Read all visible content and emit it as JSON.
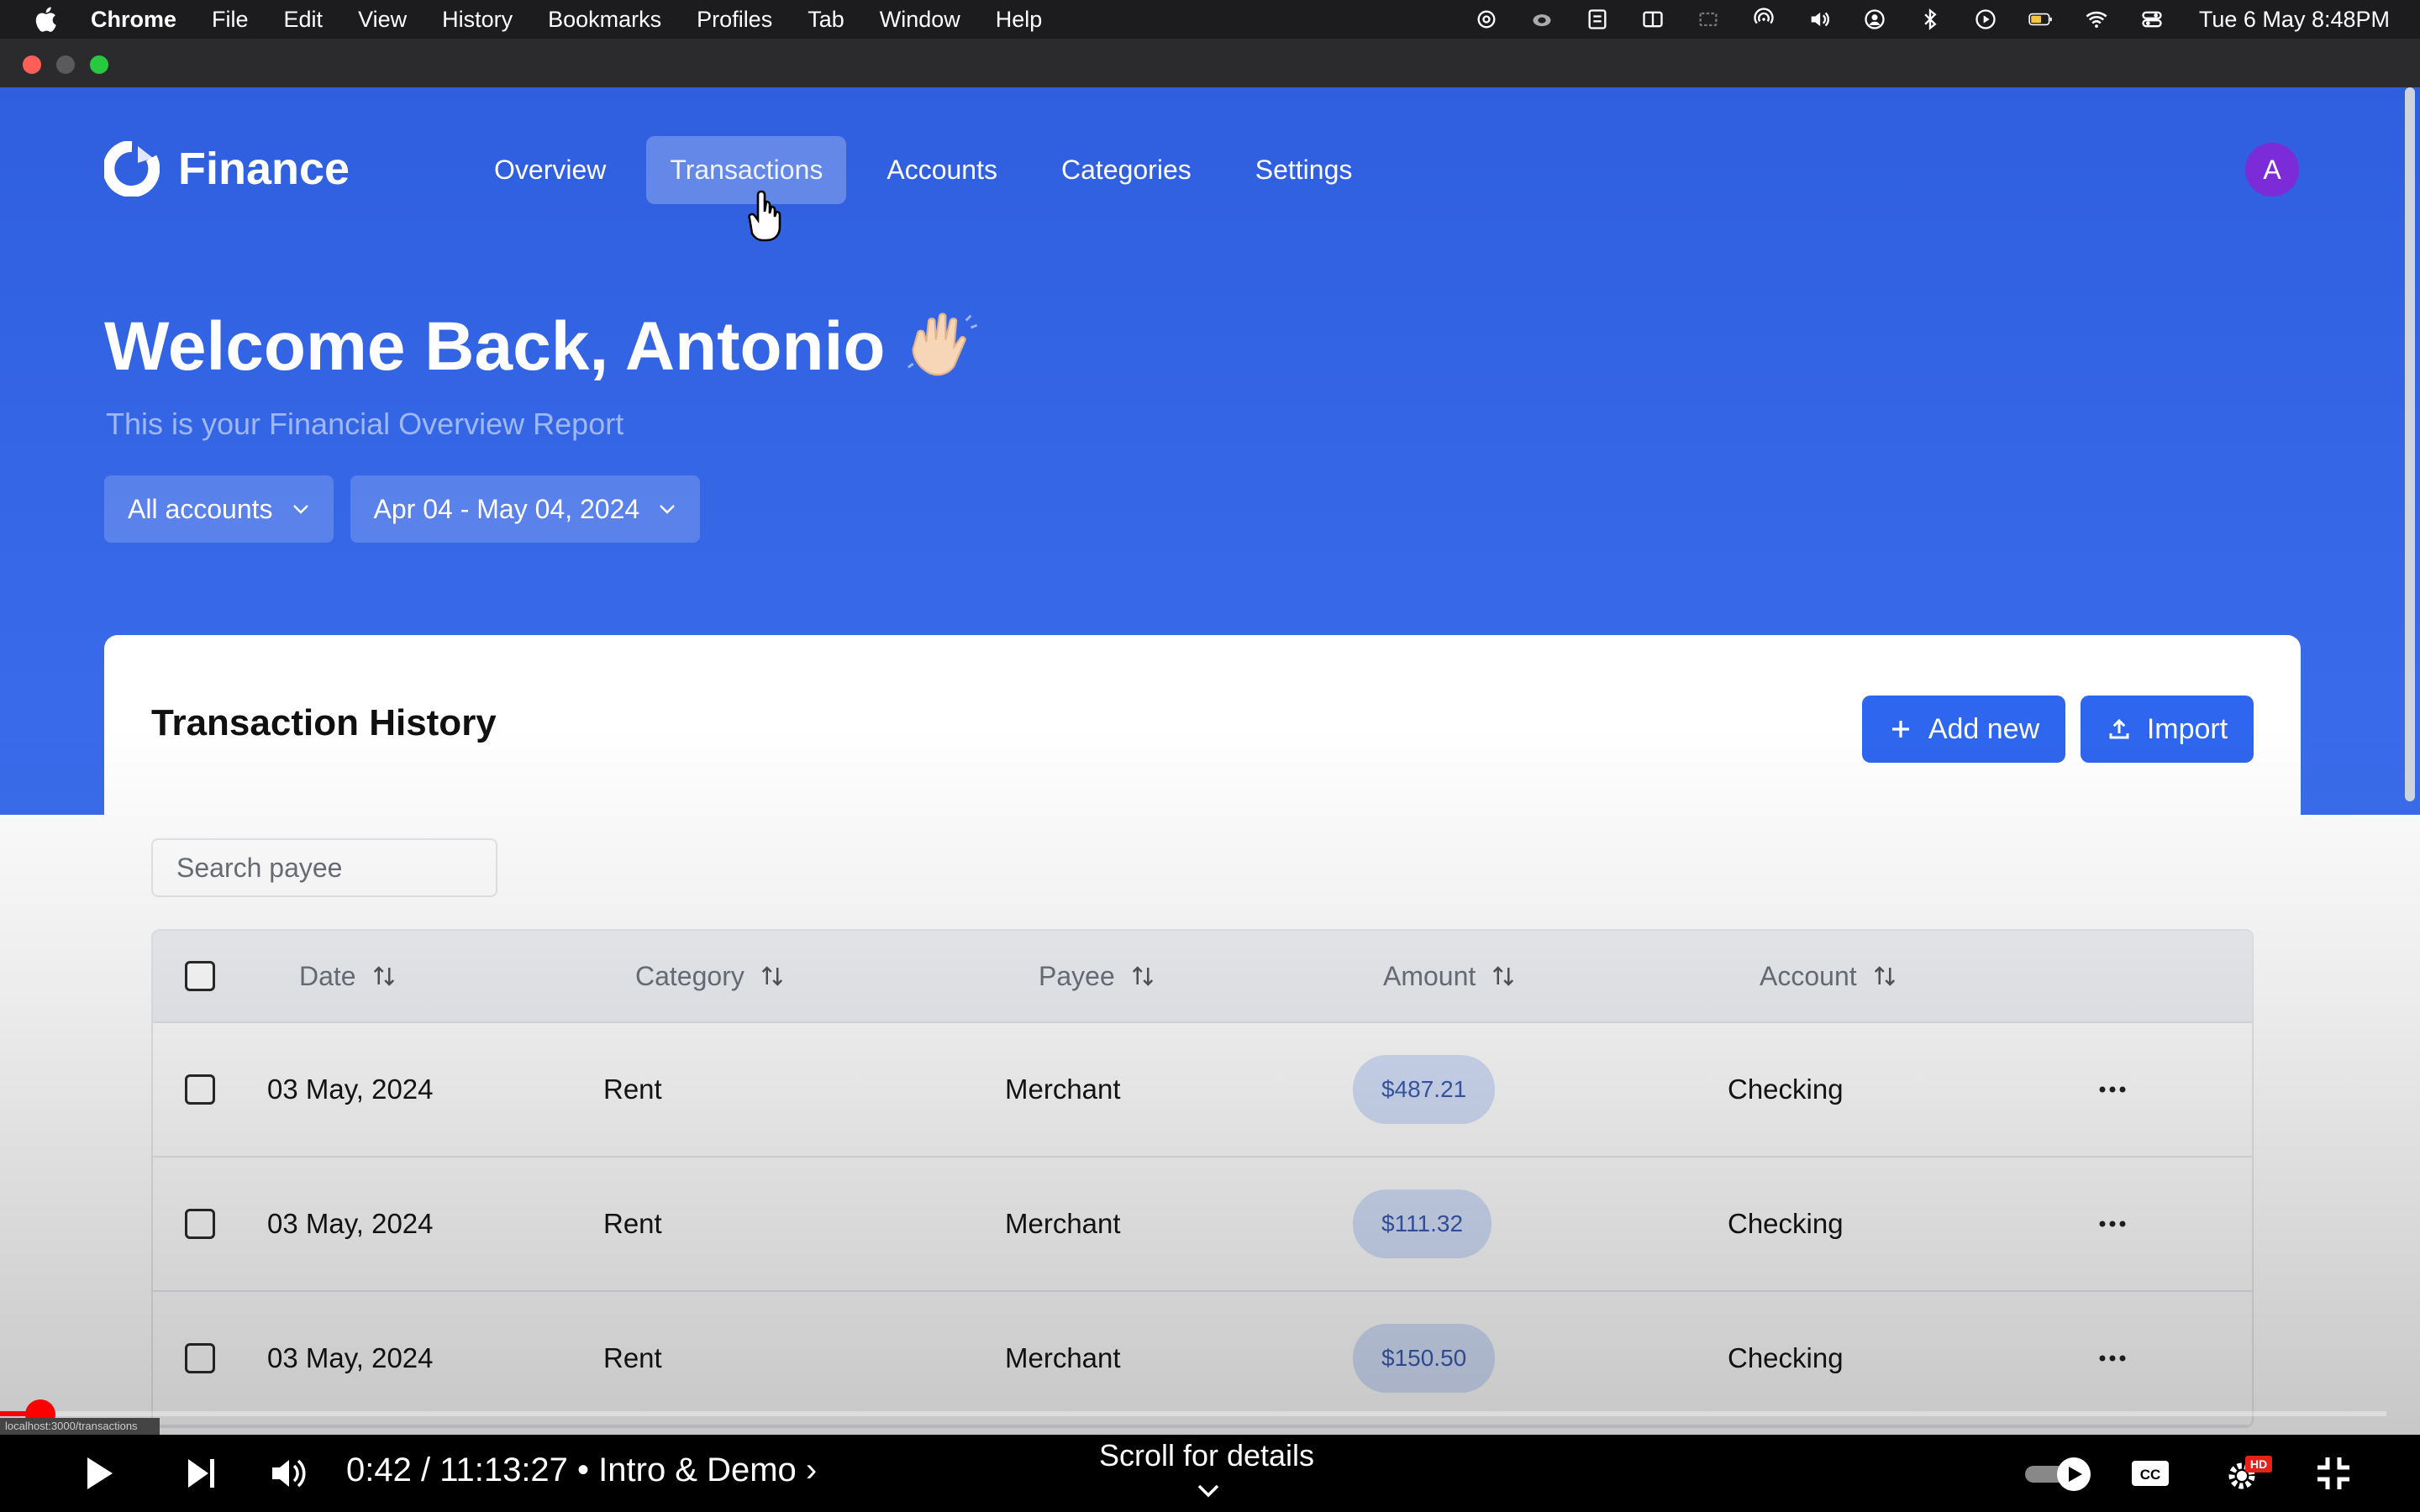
{
  "menubar": {
    "app": "Chrome",
    "items": [
      "File",
      "Edit",
      "View",
      "History",
      "Bookmarks",
      "Profiles",
      "Tab",
      "Window",
      "Help"
    ],
    "clock": "Tue 6 May  8:48PM"
  },
  "app": {
    "brand": "Finance",
    "nav": [
      "Overview",
      "Transactions",
      "Accounts",
      "Categories",
      "Settings"
    ],
    "active_nav": "Transactions",
    "avatar_initial": "A",
    "welcome": "Welcome Back, Antonio",
    "subtitle": "This is your Financial Overview Report",
    "filters": {
      "account": "All accounts",
      "date_range": "Apr 04 - May 04, 2024"
    }
  },
  "card": {
    "title": "Transaction History",
    "add_button": "Add new",
    "import_button": "Import",
    "search_placeholder": "Search payee",
    "columns": [
      "Date",
      "Category",
      "Payee",
      "Amount",
      "Account"
    ],
    "rows": [
      {
        "date": "03 May, 2024",
        "category": "Rent",
        "payee": "Merchant",
        "amount": "$487.21",
        "account": "Checking"
      },
      {
        "date": "03 May, 2024",
        "category": "Rent",
        "payee": "Merchant",
        "amount": "$111.32",
        "account": "Checking"
      },
      {
        "date": "03 May, 2024",
        "category": "Rent",
        "payee": "Merchant",
        "amount": "$150.50",
        "account": "Checking"
      }
    ]
  },
  "player": {
    "time": "0:42 / 11:13:27  •  Intro & Demo  ›",
    "scroll_hint": "Scroll for details",
    "url_tip": "localhost:3000/transactions",
    "hd_badge": "HD"
  },
  "colors": {
    "hero_blue": "#3366e6",
    "button_blue": "#2f66ef",
    "avatar_purple": "#7c2bd9",
    "amount_badge": "#d5e1fb"
  }
}
